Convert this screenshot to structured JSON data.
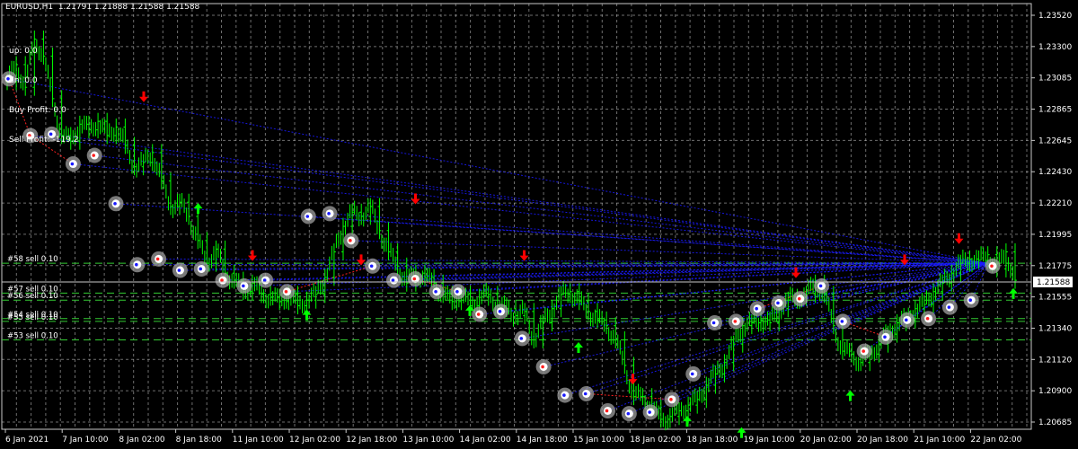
{
  "header": {
    "symbol_info": "EURUSD,H1  1.21791 1.21888 1.21588 1.21588"
  },
  "info": [
    "up: 0.0",
    "dn: 0.0",
    "Buy Profit: 0.0",
    "Sell Profit: -119.2"
  ],
  "chart_data": {
    "type": "line",
    "title": "EURUSD,H1",
    "ohlc": {
      "open": 1.21791,
      "high": 1.21888,
      "low": 1.21588,
      "close": 1.21588
    },
    "ylim": [
      1.2055,
      1.2355
    ],
    "y_ticks": [
      "1.23520",
      "1.23300",
      "1.23085",
      "1.22865",
      "1.22645",
      "1.22430",
      "1.22210",
      "1.21995",
      "1.21775",
      "1.21555",
      "1.21340",
      "1.21120",
      "1.20900",
      "1.20685"
    ],
    "current_price": "1.21588",
    "x_ticks": [
      "6 Jan 2021",
      "7 Jan 10:00",
      "8 Jan 02:00",
      "8 Jan 18:00",
      "11 Jan 10:00",
      "12 Jan 02:00",
      "12 Jan 18:00",
      "13 Jan 10:00",
      "14 Jan 02:00",
      "14 Jan 18:00",
      "15 Jan 10:00",
      "18 Jan 02:00",
      "18 Jan 18:00",
      "19 Jan 10:00",
      "20 Jan 02:00",
      "20 Jan 18:00",
      "21 Jan 10:00",
      "22 Jan 02:00"
    ],
    "series": [
      {
        "values": [
          1.23,
          1.2312,
          1.2296,
          1.233,
          1.2318,
          1.2288,
          1.2262,
          1.2258,
          1.227,
          1.2266,
          1.2272,
          1.2262,
          1.2268,
          1.2255,
          1.224,
          1.2243,
          1.225,
          1.223,
          1.2212,
          1.2215,
          1.2205,
          1.2188,
          1.2172,
          1.2182,
          1.2165,
          1.216,
          1.2152,
          1.2158,
          1.215,
          1.2148,
          1.2145,
          1.215,
          1.2142,
          1.2146,
          1.215,
          1.2162,
          1.218,
          1.2198,
          1.2208,
          1.2205,
          1.2212,
          1.2195,
          1.218,
          1.217,
          1.2158,
          1.2165,
          1.2162,
          1.2158,
          1.215,
          1.2145,
          1.215,
          1.2142,
          1.2148,
          1.215,
          1.2142,
          1.214,
          1.2135,
          1.2138,
          1.2118,
          1.213,
          1.214,
          1.215,
          1.2152,
          1.2145,
          1.2138,
          1.2132,
          1.2128,
          1.2118,
          1.21,
          1.2078,
          1.2078,
          1.207,
          1.2062,
          1.2064,
          1.2068,
          1.2072,
          1.2076,
          1.2086,
          1.2094,
          1.2102,
          1.2115,
          1.2128,
          1.213,
          1.2132,
          1.213,
          1.214,
          1.2146,
          1.2148,
          1.215,
          1.2158,
          1.215,
          1.2128,
          1.211,
          1.2108,
          1.2102,
          1.2108,
          1.2115,
          1.2122,
          1.213,
          1.2132,
          1.214,
          1.2143,
          1.2152,
          1.2158,
          1.2165,
          1.2172,
          1.2175,
          1.2174,
          1.2178,
          1.2168,
          1.218,
          1.216
        ]
      }
    ],
    "price_marker_ys": [
      1.2302,
      1.2262,
      1.2263,
      1.2242,
      1.2248,
      1.2214,
      1.2171,
      1.2175,
      1.2167,
      1.2168,
      1.216,
      1.2156,
      1.216,
      1.2152,
      1.2205,
      1.2207,
      1.2188,
      1.217,
      1.216,
      1.2161,
      1.2152,
      1.2152,
      1.2136,
      1.2138,
      1.2119,
      1.2099,
      1.2079,
      1.208,
      1.2068,
      1.2066,
      1.2067,
      1.2076,
      1.2094,
      1.213,
      1.2131,
      1.214,
      1.2144,
      1.2147,
      1.2156,
      1.2131,
      1.211,
      1.212,
      1.2132,
      1.2133,
      1.2141,
      1.2146,
      1.217
    ],
    "arrows": [
      {
        "dir": "down",
        "y": 1.229
      },
      {
        "dir": "up",
        "y": 1.221
      },
      {
        "dir": "down",
        "y": 1.2178
      },
      {
        "dir": "up",
        "y": 1.2135
      },
      {
        "dir": "down",
        "y": 1.2175
      },
      {
        "dir": "down",
        "y": 1.2218
      },
      {
        "dir": "up",
        "y": 1.2138
      },
      {
        "dir": "down",
        "y": 1.2178
      },
      {
        "dir": "up",
        "y": 1.2112
      },
      {
        "dir": "down",
        "y": 1.2091
      },
      {
        "dir": "up",
        "y": 1.206
      },
      {
        "dir": "up",
        "y": 1.2052
      },
      {
        "dir": "down",
        "y": 1.2166
      },
      {
        "dir": "up",
        "y": 1.2078
      },
      {
        "dir": "down",
        "y": 1.2175
      },
      {
        "dir": "down",
        "y": 1.219
      },
      {
        "dir": "up",
        "y": 1.215
      }
    ],
    "orders": [
      {
        "label": "#58 sell 0.10",
        "price": 1.2172
      },
      {
        "label": "#57 sell 0.10",
        "price": 1.2151
      },
      {
        "label": "#56 sell 0.10",
        "price": 1.2146
      },
      {
        "label": "#54 sell 0.10",
        "price": 1.2133
      },
      {
        "label": "#55 sell 0.10",
        "price": 1.2131
      },
      {
        "label": "#53 sell 0.10",
        "price": 1.2118
      }
    ],
    "colors": {
      "background": "#000000",
      "grid": "#c8c8c8",
      "bars": "#00ff00",
      "up_arrow": "#00ff00",
      "down_arrow": "#ff0000",
      "order_line": "#33cc33",
      "blue_links": "#1a1aff",
      "red_links": "#ff2020",
      "marker_ring": "#a0a0a0",
      "text": "#ffffff"
    },
    "grid": true
  }
}
